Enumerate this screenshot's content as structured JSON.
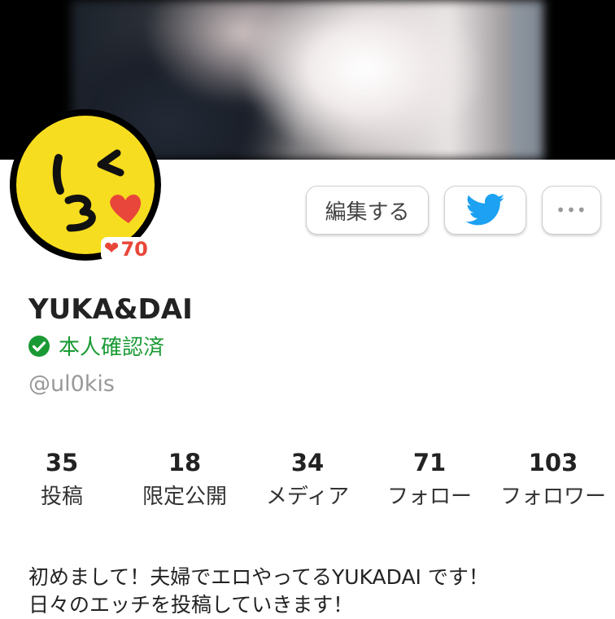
{
  "profile": {
    "name": "YUKA&DAI",
    "verified_label": "本人確認済",
    "handle": "@ul0kis",
    "likes_count": "70",
    "avatar_icon": "kissing-face-emoji",
    "cover_icon": "blurred-cover-photo"
  },
  "actions": {
    "edit_label": "編集する",
    "twitter_icon": "twitter-bird-icon",
    "more_label": "•••"
  },
  "stats": [
    {
      "value": "35",
      "label": "投稿"
    },
    {
      "value": "18",
      "label": "限定公開"
    },
    {
      "value": "34",
      "label": "メディア"
    },
    {
      "value": "71",
      "label": "フォロー"
    },
    {
      "value": "103",
      "label": "フォロワー"
    }
  ],
  "bio": [
    "初めまして！夫婦でエロやってるYUKADAI です！",
    "日々のエッチを投稿していきます！"
  ],
  "colors": {
    "verified_green": "#1a9a34",
    "heart_red": "#e8463a",
    "twitter_blue": "#1da1f2",
    "avatar_yellow": "#f7dd1f"
  }
}
